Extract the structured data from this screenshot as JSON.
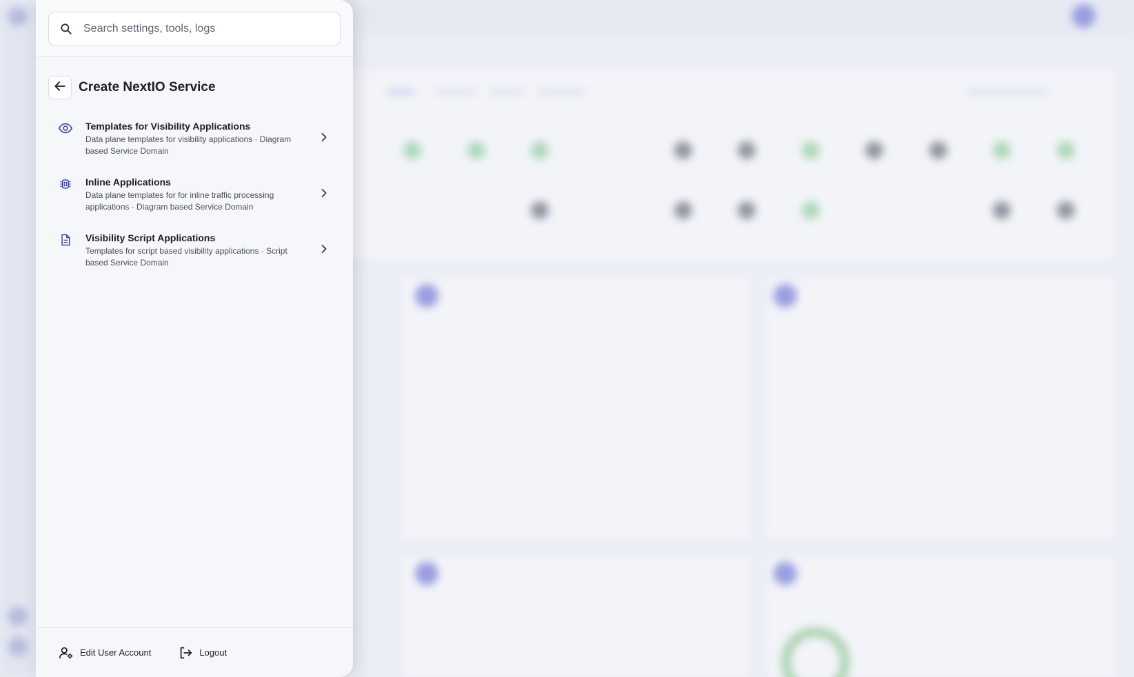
{
  "search": {
    "placeholder": "Search settings, tools, logs",
    "icon": "search-icon"
  },
  "panel": {
    "title": "Create NextIO Service",
    "back_icon": "arrow-left-icon"
  },
  "menu": {
    "items": [
      {
        "icon": "eye-icon",
        "title": "Templates for Visibility Applications",
        "description": "Data plane templates for visibility applications · Diagram based Service Domain"
      },
      {
        "icon": "chip-icon",
        "title": "Inline Applications",
        "description": "Data plane templates for for inline traffic processing applications · Diagram based Service Domain"
      },
      {
        "icon": "document-icon",
        "title": "Visibility Script Applications",
        "description": "Templates for script based visibility applications · Script based Service Domain"
      }
    ]
  },
  "footer": {
    "edit_account_label": "Edit User Account",
    "logout_label": "Logout"
  },
  "colors": {
    "accent": "#3f4aa8",
    "text_primary": "#1b1d27",
    "text_secondary": "#4a4f5c",
    "drawer_bg": "#f6f7fb"
  }
}
